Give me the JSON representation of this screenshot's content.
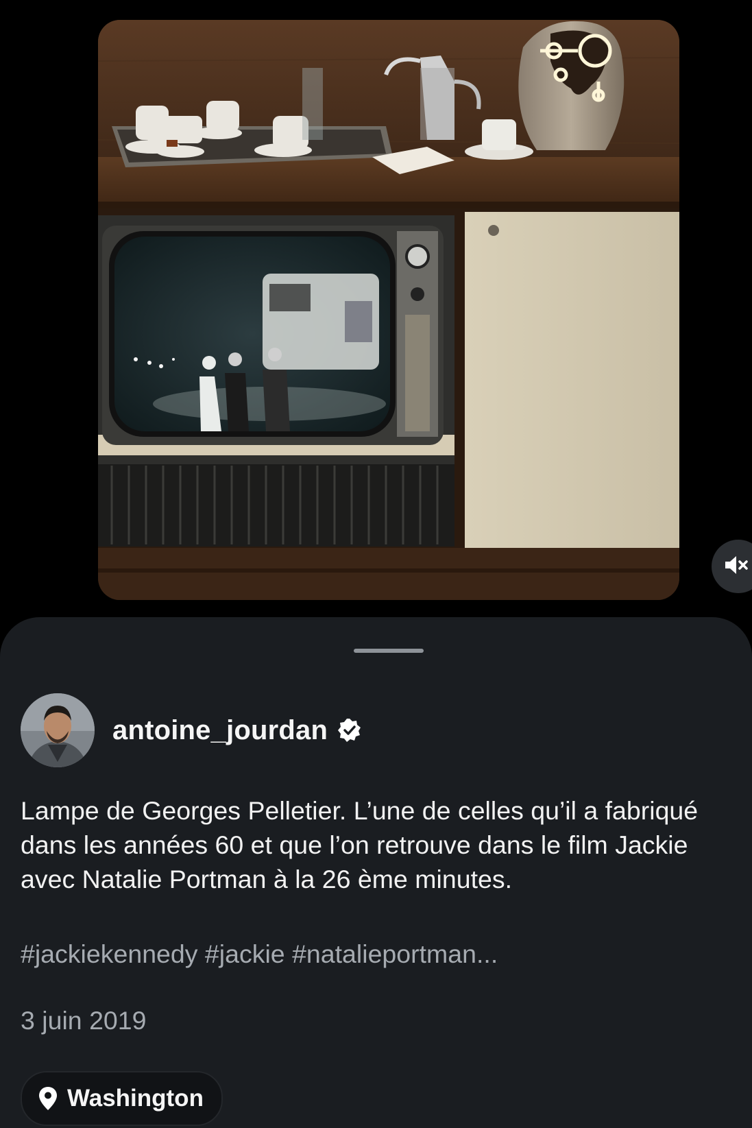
{
  "media": {
    "description_icon": "video-frame",
    "mute_icon": "speaker-muted-icon"
  },
  "post": {
    "username": "antoine_jourdan",
    "verified_icon": "verified-badge-icon",
    "caption": "Lampe de Georges Pelletier. L’une de celles qu’il a fabriqué dans les années 60 et que l’on retrouve dans le film Jackie avec Natalie Portman à la 26 ème minutes.",
    "hashtags": "#jackiekennedy #jackie #natalieportman...",
    "date": "3 juin 2019",
    "location": "Washington",
    "location_icon": "location-pin-icon"
  },
  "colors": {
    "sheet_bg": "#1a1d21",
    "text_primary": "#f2f2f2",
    "text_secondary": "#a6abb1"
  }
}
